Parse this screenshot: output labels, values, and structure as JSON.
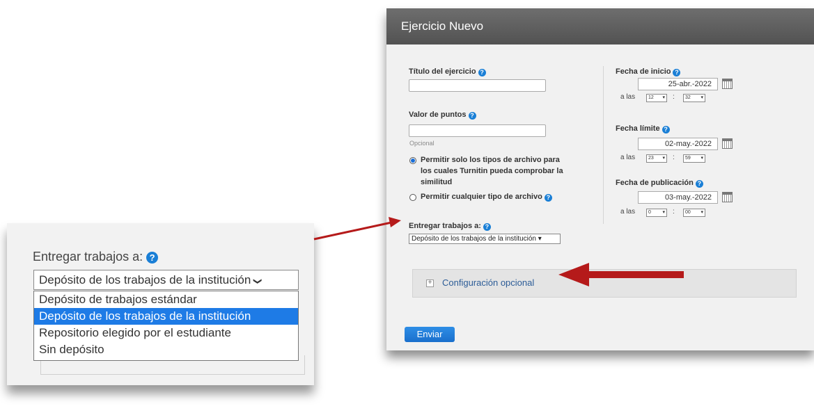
{
  "dialog": {
    "title": "Ejercicio Nuevo",
    "titulo_label": "Título del ejercicio",
    "valor_label": "Valor de puntos",
    "opcional_hint": "Opcional",
    "radio_allowed_label": "Permitir solo los tipos de archivo para los cuales Turnitin pueda comprobar la similitud",
    "radio_any_label": "Permitir cualquier tipo de archivo",
    "entregar_label": "Entregar trabajos a:",
    "entregar_value": "Depósito de los trabajos de la institución",
    "fecha_inicio": {
      "label": "Fecha de inicio",
      "date": "25-abr.-2022",
      "a_las": "a las",
      "hour": "12",
      "minute": "32"
    },
    "fecha_limite": {
      "label": "Fecha límite",
      "date": "02-may.-2022",
      "a_las": "a las",
      "hour": "23",
      "minute": "59"
    },
    "fecha_publicacion": {
      "label": "Fecha de publicación",
      "date": "03-may.-2022",
      "a_las": "a las",
      "hour": "0",
      "minute": "00"
    },
    "configuracion_label": "Configuración opcional",
    "submit_label": "Enviar",
    "help_glyph": "?",
    "colon": ":",
    "plus_glyph": "+",
    "caret_glyph": "▾"
  },
  "zoom": {
    "label": "Entregar trabajos a:",
    "selected_value": "Depósito de los trabajos de la institución",
    "options": [
      "Depósito de trabajos estándar",
      "Depósito de los trabajos de la institución",
      "Repositorio elegido por el estudiante",
      "Sin depósito"
    ],
    "highlighted_index": 1,
    "chevron_glyph": "❯"
  },
  "colors": {
    "arrow": "#b51a1a",
    "accent": "#1a7fd6",
    "header": "#5e5e5e"
  }
}
